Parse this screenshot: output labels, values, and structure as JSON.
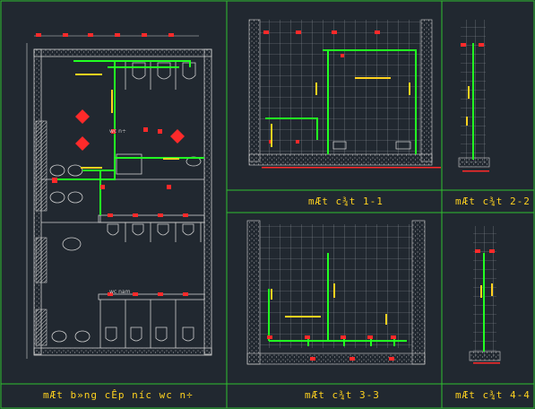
{
  "sheet": {
    "colors": {
      "background": "#212830",
      "frame": "#2fbf2f",
      "pipe": "#22ff22",
      "wall": "#cfcfcf",
      "dimension": "#ff2a2a",
      "note": "#ffd21f",
      "grid": "#9aa0a6"
    }
  },
  "titles": {
    "plan": "mÆt b»ng cÊp n­íc wc n÷",
    "section_1_1": "mÆt c¾t 1-1",
    "section_2_2": "mÆt c¾t 2-2",
    "section_3_3": "mÆt c¾t 3-3",
    "section_4_4": "mÆt c¾t 4-4"
  },
  "plan_labels": {
    "wc_nu": "wc n÷",
    "wc_nam": "wc nam"
  }
}
